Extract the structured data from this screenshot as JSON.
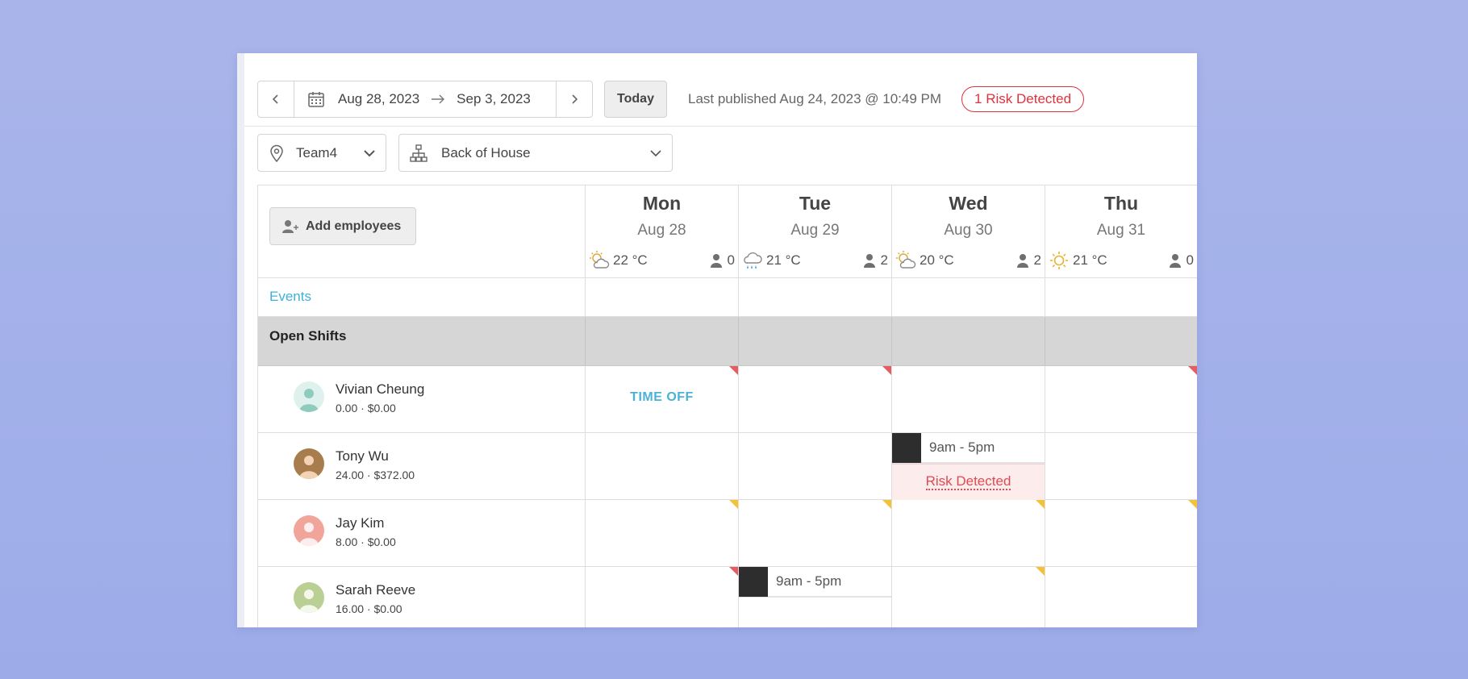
{
  "toolbar": {
    "start_date": "Aug 28, 2023",
    "end_date": "Sep 3, 2023",
    "today_label": "Today",
    "published": "Last published Aug 24, 2023 @ 10:49 PM",
    "risk_label": "1 Risk Detected"
  },
  "filters": {
    "team": "Team4",
    "department": "Back of House"
  },
  "header": {
    "add_employees_label": "Add employees",
    "events_label": "Events",
    "open_shifts_label": "Open Shifts"
  },
  "days": [
    {
      "name": "Mon",
      "date": "Aug 28",
      "weather_icon": "partly-cloudy-icon",
      "temp": "22 °C",
      "count": "0"
    },
    {
      "name": "Tue",
      "date": "Aug 29",
      "weather_icon": "rain-icon",
      "temp": "21 °C",
      "count": "2"
    },
    {
      "name": "Wed",
      "date": "Aug 30",
      "weather_icon": "partly-cloudy-icon",
      "temp": "20 °C",
      "count": "2"
    },
    {
      "name": "Thu",
      "date": "Aug 31",
      "weather_icon": "sun-icon",
      "temp": "21 °C",
      "count": "0"
    }
  ],
  "employees": [
    {
      "name": "Vivian Cheung",
      "meta": "0.00 · $0.00",
      "avatar_color": "#9fd3c7"
    },
    {
      "name": "Tony Wu",
      "meta": "24.00 · $372.00",
      "avatar_color": "#a87d4e"
    },
    {
      "name": "Jay Kim",
      "meta": "8.00 · $0.00",
      "avatar_color": "#f1a59a"
    },
    {
      "name": "Sarah Reeve",
      "meta": "16.00 · $0.00",
      "avatar_color": "#b9cf94"
    }
  ],
  "schedule": {
    "time_off_label": "TIME OFF",
    "tony_wed_shift": "9am - 5pm",
    "tony_wed_risk": "Risk Detected",
    "sarah_tue_shift": "9am - 5pm"
  },
  "colors": {
    "accent_blue": "#4ab2d9",
    "risk_red": "#e0323e",
    "flag_red": "#e35d62",
    "flag_yellow": "#f4c238"
  }
}
